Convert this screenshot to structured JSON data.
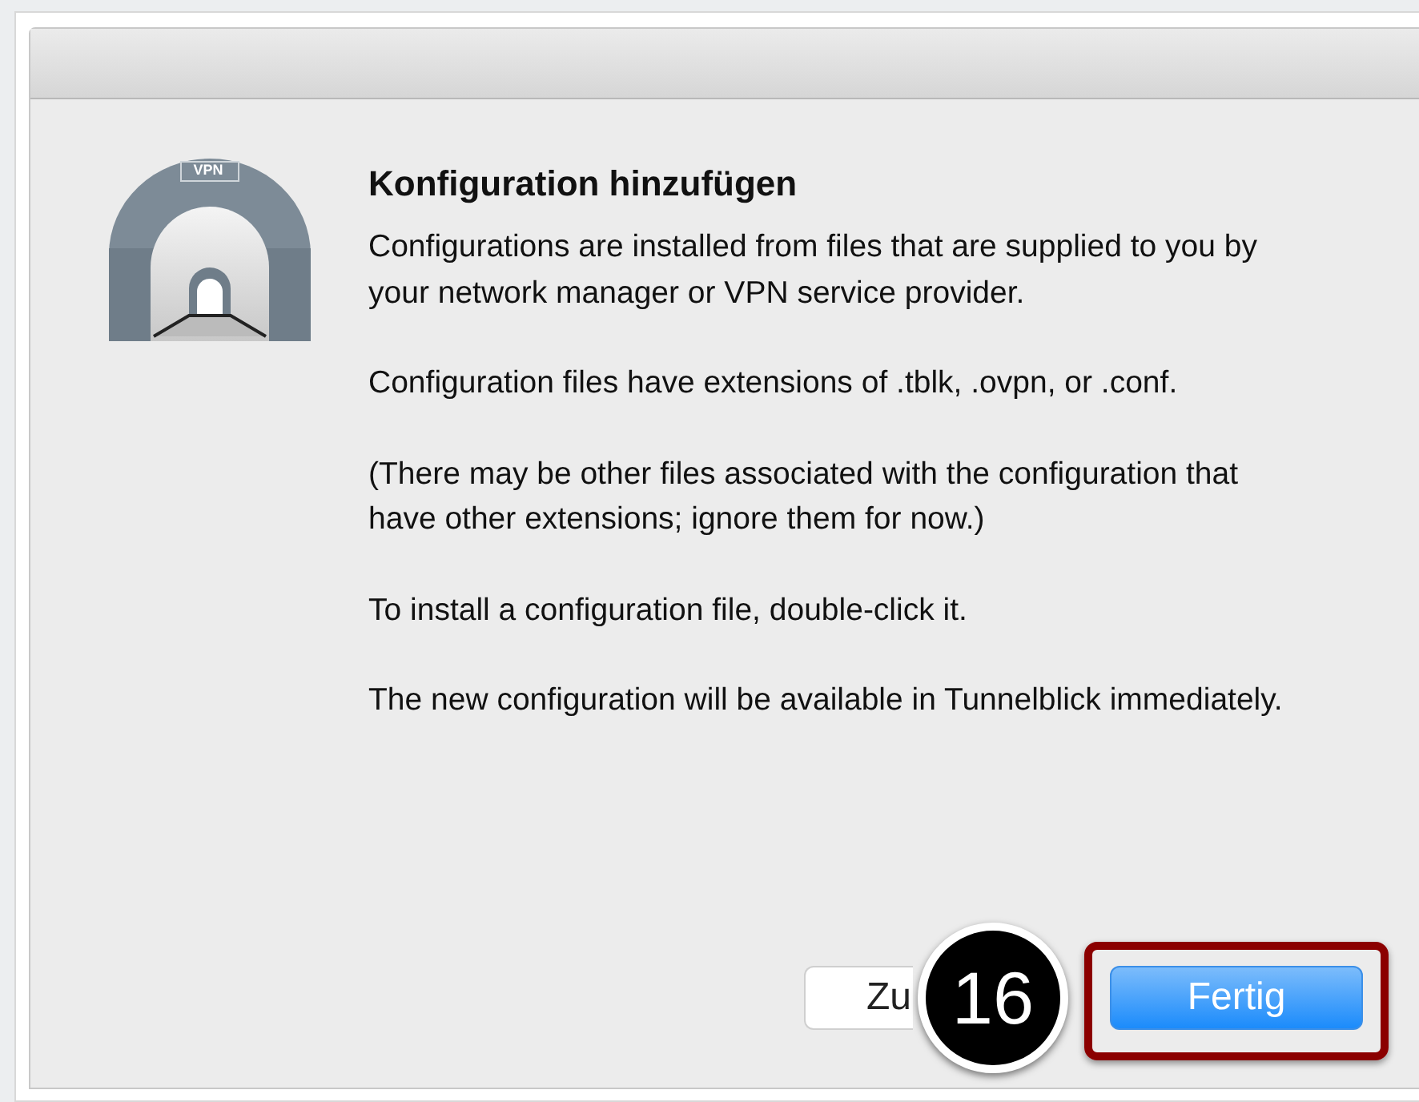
{
  "dialog": {
    "title": "Konfiguration hinzufügen",
    "paragraphs": [
      "Configurations are installed from files that are supplied to you by your network manager or VPN service provider.",
      "Configuration files have extensions of .tblk, .ovpn, or .conf.",
      "(There may be other files associated with the configuration that have other extensions; ignore them for now.)",
      "To install a configuration file, double-click it.",
      "The new configuration will be available in Tunnelblick immediately."
    ],
    "icon_label": "VPN",
    "buttons": [
      {
        "label": "Zu",
        "kind": "secondary"
      },
      {
        "label": "Fertig",
        "kind": "primary"
      }
    ]
  },
  "callout": {
    "number": "16"
  }
}
